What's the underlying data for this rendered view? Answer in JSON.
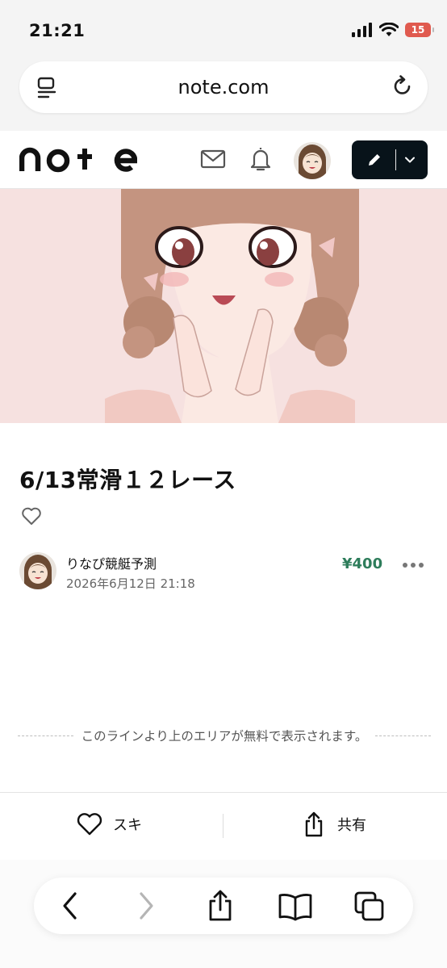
{
  "status_bar": {
    "time": "21:21",
    "battery": "15"
  },
  "browser": {
    "url": "note.com"
  },
  "header": {
    "logo": "note",
    "icons": [
      "mail-icon",
      "bell-icon",
      "avatar",
      "pen-icon",
      "chevron-down-icon"
    ]
  },
  "article": {
    "title": "6/13常滑１２レース",
    "author": "りなぴ競艇予測",
    "date": "2026年6月12日 21:18",
    "price": "¥400"
  },
  "paywall_notice": "このラインより上のエリアが無料で表示されます。",
  "actions": {
    "like_label": "スキ",
    "share_label": "共有"
  },
  "colors": {
    "price": "#2e7d5b",
    "post_button": "#08131a",
    "battery": "#e05a4f",
    "hero_bg": "#f6e1e0"
  }
}
